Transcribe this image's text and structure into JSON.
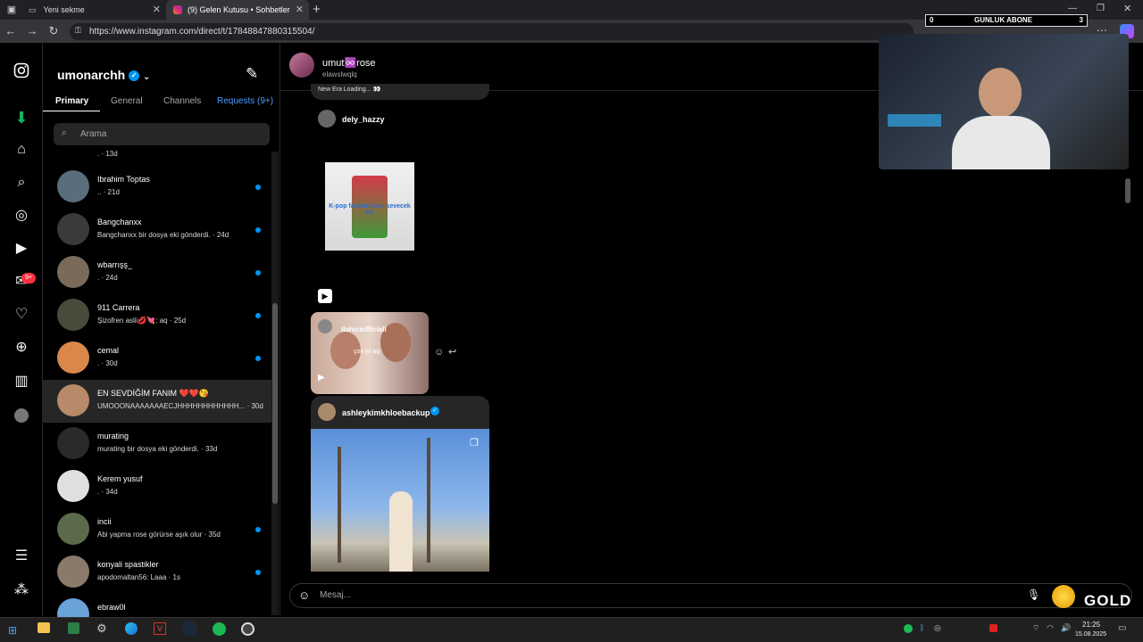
{
  "browser": {
    "tabs": [
      {
        "title": "Yeni sekme"
      },
      {
        "title": "(9) Gelen Kutusu • Sohbetler"
      }
    ],
    "url": "https://www.instagram.com/direct/t/17848847880315504/"
  },
  "inbox": {
    "username": "umonarchh",
    "tabs": [
      "Primary",
      "General",
      "Channels",
      "Requests (9+)"
    ],
    "search_placeholder": "Arama",
    "top_partial_sub": ". · 13d",
    "conversations": [
      {
        "name": "Ibrahim Toptas",
        "sub": ".. · 21d",
        "unread": true
      },
      {
        "name": "Bangchanxx",
        "sub": "Bangchanxx bir dosya eki gönderdi. · 24d",
        "unread": true
      },
      {
        "name": "wbarrışş_",
        "sub": ". · 24d",
        "unread": true
      },
      {
        "name": "911 Carrera",
        "sub": "Şizofren aslii💋💘: aq · 25d",
        "unread": true
      },
      {
        "name": "cemal",
        "sub": ". · 30d",
        "unread": true
      },
      {
        "name": "EN SEVDİĞİM FANIM ❤️❤️😘",
        "sub": "UMOOONAAAAAAAECJHHHHHHHHHHHH... · 30d",
        "unread": false,
        "selected": true
      },
      {
        "name": "murating",
        "sub": "murating bir dosya eki gönderdi. · 33d",
        "unread": false
      },
      {
        "name": "Kerem yusuf",
        "sub": ". · 34d",
        "unread": false
      },
      {
        "name": "incii",
        "sub": "Abi yapma rose görürse aşık olur · 35d",
        "unread": true
      },
      {
        "name": "konyali spastikler",
        "sub": "apodomaltan56: Laaa · 1s",
        "unread": true
      },
      {
        "name": "ebraw0l",
        "sub": "",
        "unread": false
      }
    ]
  },
  "chat": {
    "name": "umut♾️rose",
    "handle": "elawslwqlq",
    "partial_top_text": "New Era Loading... 👀",
    "post1_user": "dely_hazzy",
    "post1_image_text": "K-pop fanları bunu sevecek adi",
    "reel_user": "ilahiciofficiall",
    "reel_caption": "çok iyi aq",
    "post2_user": "ashleykimkhloebackup",
    "message_placeholder": "Mesaj..."
  },
  "nav_badges": {
    "messages": "9+"
  },
  "overlay": {
    "abone_left": "0",
    "abone_label": "GUNLUK ABONE",
    "abone_right": "3",
    "gold_label": "GOLD"
  },
  "taskbar": {
    "time": "21:25",
    "date": "15.08.2025"
  },
  "colors": {
    "accent": "#0095f6",
    "badge": "#ff3040",
    "background": "#000000"
  }
}
